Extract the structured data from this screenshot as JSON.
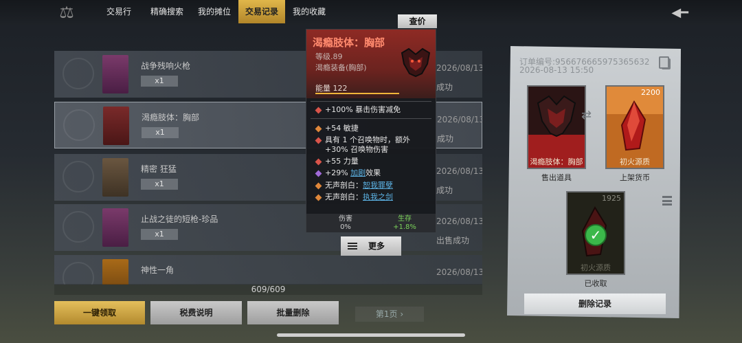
{
  "nav": {
    "tabs": [
      {
        "label": "交易行"
      },
      {
        "label": "精确搜索"
      },
      {
        "label": "我的摊位"
      },
      {
        "label": "交易记录"
      },
      {
        "label": "我的收藏"
      }
    ],
    "active_tab": 3
  },
  "records": [
    {
      "name": "战争残响火枪",
      "qty": "x1",
      "date": "2026/08/13",
      "status": "成功"
    },
    {
      "name": "渴瘾肢体：胸部",
      "qty": "x1",
      "date": "2026/08/13",
      "status": "成功"
    },
    {
      "name": "精密 狂猛",
      "qty": "x1",
      "date": "2026/08/13",
      "status": "成功"
    },
    {
      "name": "止战之徒的短枪-珍品",
      "qty": "x1",
      "date": "2026/08/13",
      "status": "出售成功"
    },
    {
      "name": "神性一角",
      "qty": "",
      "date": "2026/08/13",
      "status": ""
    }
  ],
  "counter": "609/609",
  "buttons": {
    "claim_all": "一键领取",
    "tax_info": "税费说明",
    "batch_delete": "批量删除",
    "page": "第1页"
  },
  "tooltip": {
    "price_check": "查价",
    "title": "渴瘾肢体：胸部",
    "level": "等级.89",
    "type": "渴瘾装备(胸部)",
    "energy": "能量 122",
    "main_stat": "+100% 暴击伤害减免",
    "stats": [
      {
        "text": "+54 敏捷",
        "color": "#e0873a"
      },
      {
        "text": "具有 1 个召唤物时，额外",
        "text2": "+30% 召唤物伤害",
        "color": "#d9544a"
      },
      {
        "text": "+55 力量",
        "color": "#d9544a"
      },
      {
        "prefix": "+29% ",
        "link": "加剧",
        "suffix": "效果",
        "color": "#a06ad8"
      },
      {
        "prefix": "无声剖白：",
        "link": "恕我罪孽",
        "color": "#e0873a"
      },
      {
        "prefix": "无声剖白：",
        "link": "执我之剑",
        "color": "#e0873a"
      }
    ],
    "footer": {
      "damage_label": "伤害",
      "damage_value": "0%",
      "survive_label": "生存",
      "survive_value": "+1.8%"
    },
    "more": "更多"
  },
  "order": {
    "order_no": "订单编号:9566766659753656​32",
    "time": "2026-08-13 15:50",
    "sold_item_name": "渴瘾肢体：胸部",
    "sold_label": "售出道具",
    "currency_name": "初火源质",
    "currency_amount": "2200",
    "currency_label": "上架货币",
    "received_amount": "1925",
    "received_name": "初火源质",
    "received_label": "已收取",
    "delete": "删除记录"
  },
  "colors": {
    "gold_accent": "#e0b64a",
    "title_red": "#ff8a6e",
    "link_blue": "#5db4e6",
    "survive_green": "#7bd35a"
  }
}
